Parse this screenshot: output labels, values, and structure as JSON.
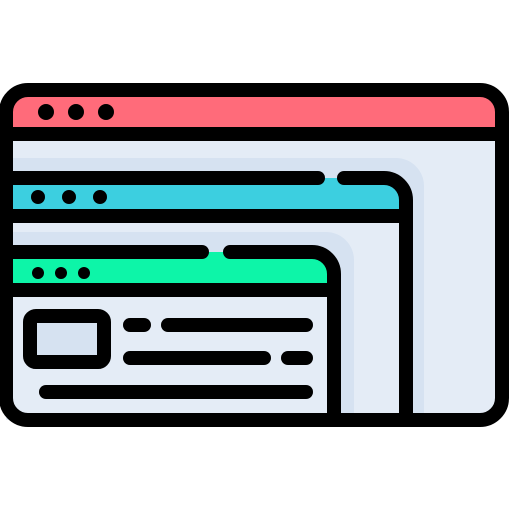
{
  "icon": {
    "name": "multiple-browser-windows-icon",
    "colors": {
      "outline": "#000000",
      "window_body": "#e4ecf6",
      "window_inner_shadow": "#d6e2f1",
      "back_titlebar": "#ff6b7a",
      "middle_titlebar": "#3ccfe0",
      "front_titlebar": "#0df5a8",
      "image_placeholder": "#d6e2f1",
      "dots": "#000000"
    },
    "windows": [
      {
        "name": "back-window",
        "dots": 3
      },
      {
        "name": "middle-window",
        "dots": 3
      },
      {
        "name": "front-window",
        "dots": 3
      }
    ]
  }
}
